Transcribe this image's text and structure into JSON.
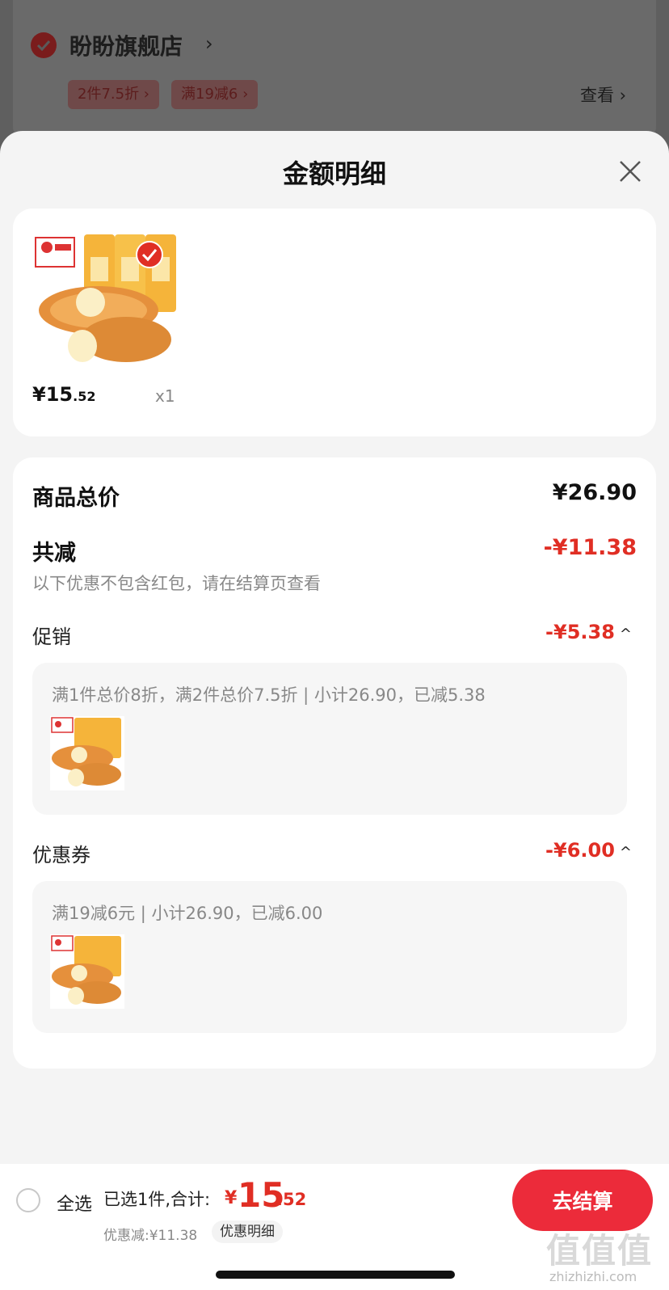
{
  "store": {
    "name": "盼盼旗舰店",
    "tags": [
      "2件7.5折 ›",
      "满19减6 ›"
    ],
    "view_link": "查看 ›"
  },
  "sheet": {
    "title": "金额明细"
  },
  "product": {
    "price_int": "¥15",
    "price_dec": ".52",
    "qty": "x1"
  },
  "summary": {
    "total_label": "商品总价",
    "total_value": "¥26.90",
    "reduce_label": "共减",
    "reduce_value": "-¥11.38",
    "note": "以下优惠不包含红包，请在结算页查看",
    "promo_label": "促销",
    "promo_value": "-¥5.38",
    "promo_detail": "满1件总价8折，满2件总价7.5折 | 小计26.90，已减5.38",
    "coupon_label": "优惠券",
    "coupon_value": "-¥6.00",
    "coupon_detail": "满19减6元 | 小计26.90，已减6.00"
  },
  "bottom": {
    "select_all": "全选",
    "selected_text": "已选1件,合计:",
    "yen": "¥",
    "total_int": "15",
    "total_dec": ".52",
    "discount": "优惠减:¥11.38",
    "detail_chip": "优惠明细",
    "checkout": "去结算"
  },
  "watermark": {
    "text": "值值值",
    "url": "zhizhizhi.com"
  },
  "colors": {
    "accent": "#e02e24",
    "button": "#ec2b3a"
  }
}
